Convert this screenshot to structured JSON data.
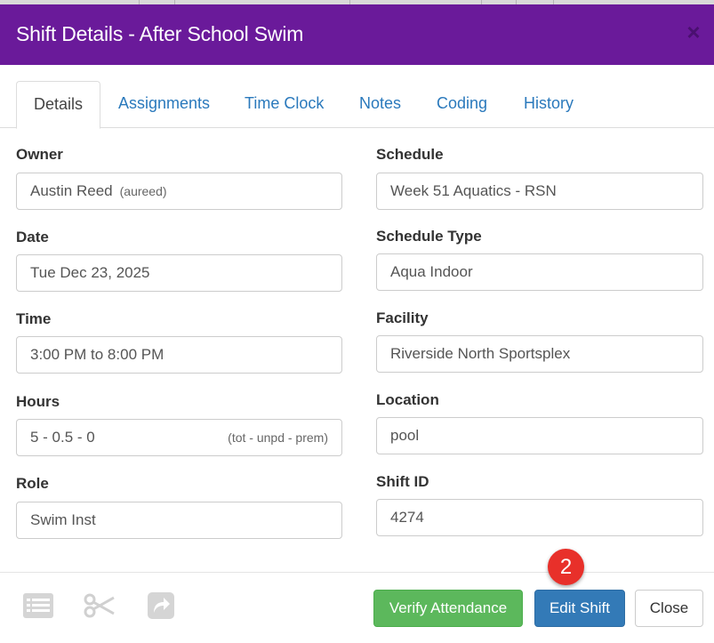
{
  "dialog": {
    "title": "Shift Details - After School Swim",
    "close_symbol": "×"
  },
  "tabs": [
    {
      "label": "Details",
      "active": true
    },
    {
      "label": "Assignments",
      "active": false
    },
    {
      "label": "Time Clock",
      "active": false
    },
    {
      "label": "Notes",
      "active": false
    },
    {
      "label": "Coding",
      "active": false
    },
    {
      "label": "History",
      "active": false
    }
  ],
  "left": {
    "owner": {
      "label": "Owner",
      "value": "Austin Reed",
      "hint": "(aureed)"
    },
    "date": {
      "label": "Date",
      "value": "Tue Dec 23, 2025"
    },
    "time": {
      "label": "Time",
      "value": "3:00 PM to 8:00 PM"
    },
    "hours": {
      "label": "Hours",
      "value": "5 - 0.5 - 0",
      "hint": "(tot - unpd - prem)"
    },
    "role": {
      "label": "Role",
      "value": "Swim Inst"
    }
  },
  "right": {
    "schedule": {
      "label": "Schedule",
      "value": "Week 51 Aquatics - RSN"
    },
    "schedule_type": {
      "label": "Schedule Type",
      "value": "Aqua Indoor"
    },
    "facility": {
      "label": "Facility",
      "value": "Riverside North Sportsplex"
    },
    "location": {
      "label": "Location",
      "value": "pool"
    },
    "shift_id": {
      "label": "Shift ID",
      "value": "4274"
    }
  },
  "footer": {
    "icons": [
      "list-icon",
      "scissors-icon",
      "share-arrow-icon"
    ],
    "verify_label": "Verify Attendance",
    "edit_label": "Edit Shift",
    "close_label": "Close",
    "step_badge": "2"
  },
  "colors": {
    "header": "#6a1a9a",
    "tab_link": "#2a79bc",
    "verify": "#5cb85c",
    "edit": "#337ab7",
    "badge": "#e8302a"
  }
}
